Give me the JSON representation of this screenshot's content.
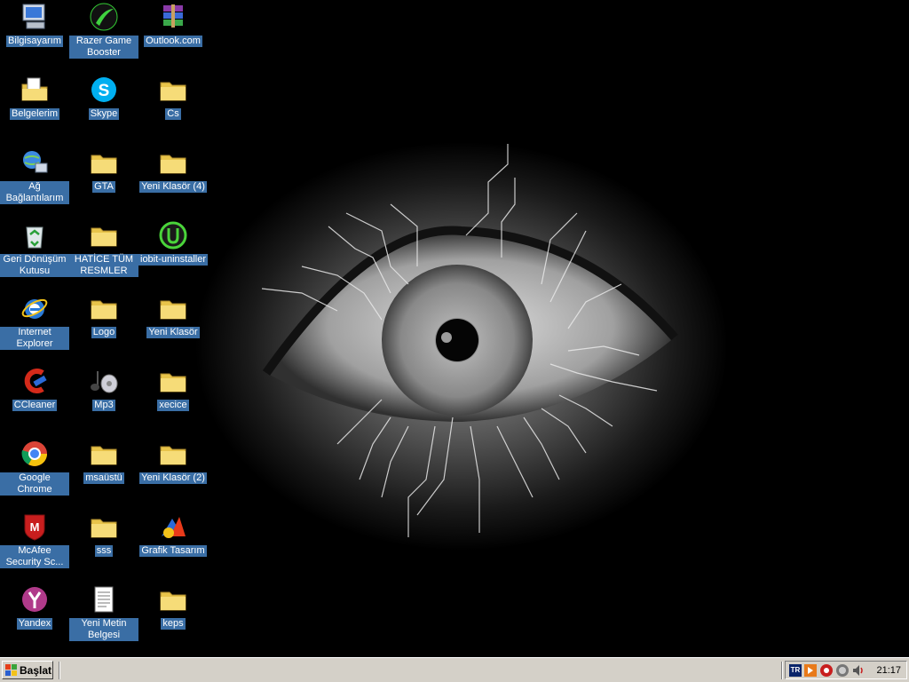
{
  "desktop": {
    "icons": [
      {
        "label": "Bilgisayarım",
        "icon": "computer-icon"
      },
      {
        "label": "Razer Game Booster",
        "icon": "razer-icon"
      },
      {
        "label": "Outlook.com",
        "icon": "winrar-icon"
      },
      {
        "label": "Belgelerim",
        "icon": "documents-folder-icon"
      },
      {
        "label": "Skype",
        "icon": "skype-icon"
      },
      {
        "label": "Cs",
        "icon": "folder-icon"
      },
      {
        "label": "Ağ Bağlantılarım",
        "icon": "network-icon"
      },
      {
        "label": "GTA",
        "icon": "folder-icon"
      },
      {
        "label": "Yeni Klasör (4)",
        "icon": "folder-icon"
      },
      {
        "label": "Geri Dönüşüm Kutusu",
        "icon": "recycle-bin-icon"
      },
      {
        "label": "HATİCE TÜM RESMLER",
        "icon": "folder-icon"
      },
      {
        "label": "iobit-uninstaller",
        "icon": "iobit-icon"
      },
      {
        "label": "Internet Explorer",
        "icon": "internet-explorer-icon"
      },
      {
        "label": "Logo",
        "icon": "folder-icon"
      },
      {
        "label": "Yeni Klasör",
        "icon": "folder-icon"
      },
      {
        "label": "CCleaner",
        "icon": "ccleaner-icon"
      },
      {
        "label": "Mp3",
        "icon": "music-icon"
      },
      {
        "label": "xecice",
        "icon": "folder-icon"
      },
      {
        "label": "Google Chrome",
        "icon": "chrome-icon"
      },
      {
        "label": "msaüstü",
        "icon": "folder-icon"
      },
      {
        "label": "Yeni Klasör (2)",
        "icon": "folder-icon"
      },
      {
        "label": "McAfee Security Sc...",
        "icon": "mcafee-icon"
      },
      {
        "label": "sss",
        "icon": "folder-icon"
      },
      {
        "label": "Grafik Tasarım",
        "icon": "graphics-icon"
      },
      {
        "label": "Yandex",
        "icon": "yandex-icon"
      },
      {
        "label": "Yeni Metin Belgesi",
        "icon": "text-document-icon"
      },
      {
        "label": "keps",
        "icon": "folder-icon"
      }
    ]
  },
  "taskbar": {
    "start_label": "Başlat",
    "language": "TR",
    "clock": "21:17",
    "tray_icons": [
      "update-icon",
      "security-icon",
      "network-tray-icon",
      "volume-icon"
    ]
  },
  "colors": {
    "label_highlight": "#3a6ea5",
    "taskbar": "#d4d0c8",
    "desktop_bg": "#000000"
  }
}
